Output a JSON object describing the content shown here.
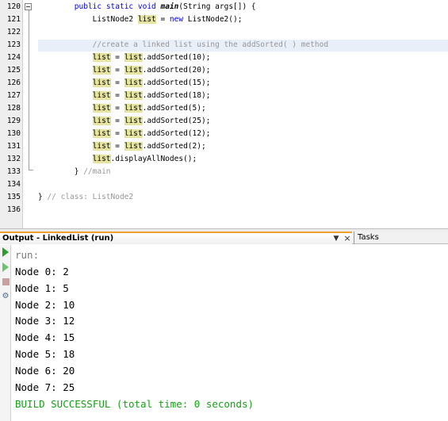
{
  "editor": {
    "lines": [
      {
        "num": "120",
        "segments": [
          {
            "t": "        ",
            "c": ""
          },
          {
            "t": "public",
            "c": "kw"
          },
          {
            "t": " ",
            "c": ""
          },
          {
            "t": "static",
            "c": "kw"
          },
          {
            "t": " ",
            "c": ""
          },
          {
            "t": "void",
            "c": "kw"
          },
          {
            "t": " ",
            "c": ""
          },
          {
            "t": "main",
            "c": "fn"
          },
          {
            "t": "(String args[]) {",
            "c": ""
          }
        ]
      },
      {
        "num": "121",
        "segments": [
          {
            "t": "            ListNode2 ",
            "c": ""
          },
          {
            "t": "list",
            "c": "hl"
          },
          {
            "t": " = ",
            "c": ""
          },
          {
            "t": "new",
            "c": "kw"
          },
          {
            "t": " ListNode2();",
            "c": ""
          }
        ]
      },
      {
        "num": "122",
        "segments": []
      },
      {
        "num": "123",
        "segments": [
          {
            "t": "            ",
            "c": ""
          },
          {
            "t": "//create a linked list using the addSorted( ) method",
            "c": "cm"
          }
        ]
      },
      {
        "num": "124",
        "segments": [
          {
            "t": "            ",
            "c": ""
          },
          {
            "t": "list",
            "c": "hl"
          },
          {
            "t": " = ",
            "c": ""
          },
          {
            "t": "list",
            "c": "hl"
          },
          {
            "t": ".addSorted(10);",
            "c": ""
          }
        ]
      },
      {
        "num": "125",
        "segments": [
          {
            "t": "            ",
            "c": ""
          },
          {
            "t": "list",
            "c": "hl"
          },
          {
            "t": " = ",
            "c": ""
          },
          {
            "t": "list",
            "c": "hl"
          },
          {
            "t": ".addSorted(20);",
            "c": ""
          }
        ]
      },
      {
        "num": "126",
        "segments": [
          {
            "t": "            ",
            "c": ""
          },
          {
            "t": "list",
            "c": "hl"
          },
          {
            "t": " = ",
            "c": ""
          },
          {
            "t": "list",
            "c": "hl"
          },
          {
            "t": ".addSorted(15);",
            "c": ""
          }
        ]
      },
      {
        "num": "127",
        "segments": [
          {
            "t": "            ",
            "c": ""
          },
          {
            "t": "list",
            "c": "hl"
          },
          {
            "t": " = ",
            "c": ""
          },
          {
            "t": "list",
            "c": "hl"
          },
          {
            "t": ".addSorted(18);",
            "c": ""
          }
        ]
      },
      {
        "num": "128",
        "segments": [
          {
            "t": "            ",
            "c": ""
          },
          {
            "t": "list",
            "c": "hl"
          },
          {
            "t": " = ",
            "c": ""
          },
          {
            "t": "list",
            "c": "hl"
          },
          {
            "t": ".addSorted(5);",
            "c": ""
          }
        ]
      },
      {
        "num": "129",
        "segments": [
          {
            "t": "            ",
            "c": ""
          },
          {
            "t": "list",
            "c": "hl"
          },
          {
            "t": " = ",
            "c": ""
          },
          {
            "t": "list",
            "c": "hl"
          },
          {
            "t": ".addSorted(25);",
            "c": ""
          }
        ]
      },
      {
        "num": "130",
        "segments": [
          {
            "t": "            ",
            "c": ""
          },
          {
            "t": "list",
            "c": "hl"
          },
          {
            "t": " = ",
            "c": ""
          },
          {
            "t": "list",
            "c": "hl"
          },
          {
            "t": ".addSorted(12);",
            "c": ""
          }
        ]
      },
      {
        "num": "131",
        "segments": [
          {
            "t": "            ",
            "c": ""
          },
          {
            "t": "list",
            "c": "hl"
          },
          {
            "t": " = ",
            "c": ""
          },
          {
            "t": "list",
            "c": "hl"
          },
          {
            "t": ".addSorted(2);",
            "c": ""
          }
        ]
      },
      {
        "num": "132",
        "segments": [
          {
            "t": "            ",
            "c": ""
          },
          {
            "t": "list",
            "c": "hl"
          },
          {
            "t": ".displayAllNodes();",
            "c": ""
          }
        ]
      },
      {
        "num": "133",
        "segments": [
          {
            "t": "        } ",
            "c": ""
          },
          {
            "t": "//main",
            "c": "cm"
          }
        ]
      },
      {
        "num": "134",
        "segments": []
      },
      {
        "num": "135",
        "segments": [
          {
            "t": "} ",
            "c": ""
          },
          {
            "t": "// class: ListNode2",
            "c": "cm"
          }
        ]
      },
      {
        "num": "136",
        "segments": []
      }
    ]
  },
  "output_window": {
    "title": "Output - LinkedList (run)",
    "menu_icon": "dropdown-menu-icon",
    "close_icon": "close-icon",
    "tasks_label": "Tasks",
    "toolbar_icons": [
      "rerun-icon",
      "rerun-with-arguments-icon",
      "stop-icon",
      "settings-icon"
    ],
    "lines": [
      {
        "text": "run:",
        "style": "ogray"
      },
      {
        "text": "Node 0: 2",
        "style": ""
      },
      {
        "text": "Node 1: 5",
        "style": ""
      },
      {
        "text": "Node 2: 10",
        "style": ""
      },
      {
        "text": "Node 3: 12",
        "style": ""
      },
      {
        "text": "Node 4: 15",
        "style": ""
      },
      {
        "text": "Node 5: 18",
        "style": ""
      },
      {
        "text": "Node 6: 20",
        "style": ""
      },
      {
        "text": "Node 7: 25",
        "style": ""
      },
      {
        "text": "BUILD SUCCESSFUL (total time: 0 seconds)",
        "style": "ogreen"
      }
    ]
  },
  "colors": {
    "keyword": "#0000e6",
    "comment": "#969696",
    "occurrence_highlight": "#e4e4a0",
    "build_success": "#15a015",
    "active_tab_accent": "#f0a030"
  }
}
